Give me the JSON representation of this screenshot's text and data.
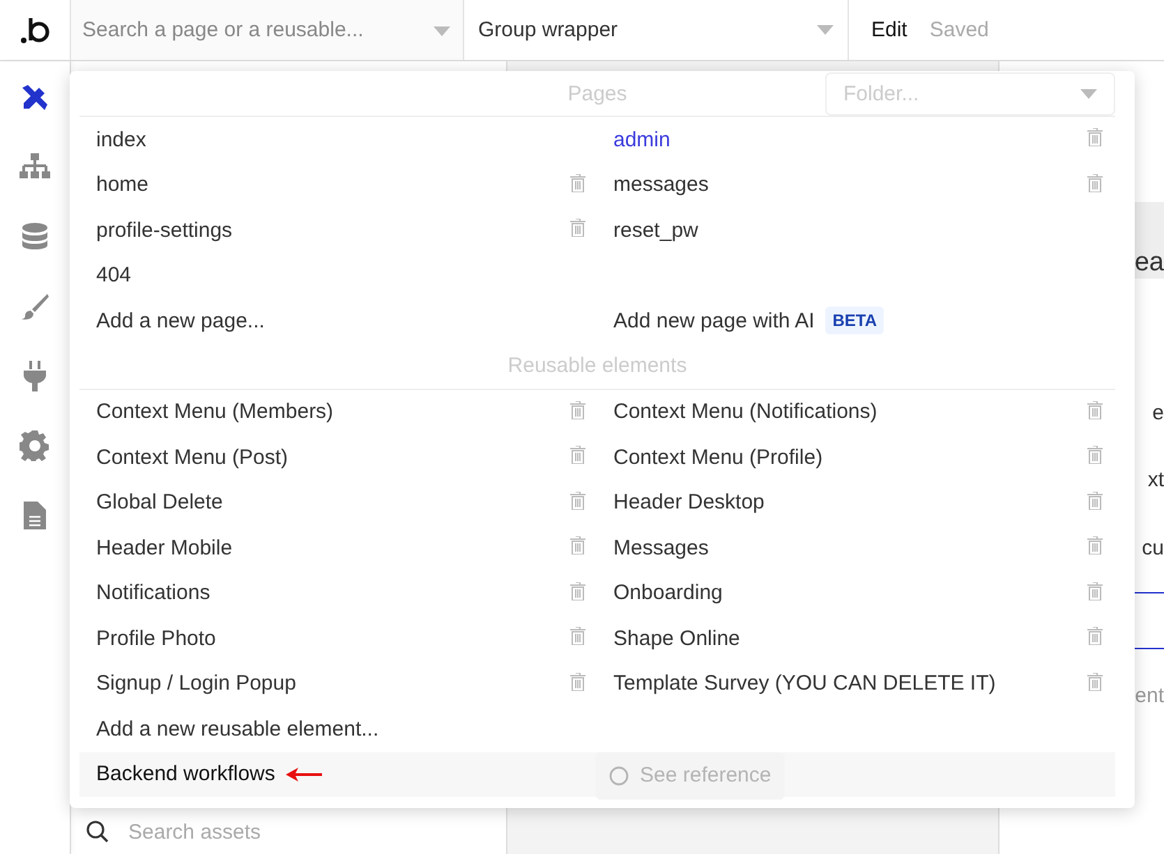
{
  "topbar": {
    "search": {
      "placeholder": "Search a page or a reusable..."
    },
    "element_select": {
      "value": "Group wrapper"
    },
    "mode": "Edit",
    "status": "Saved"
  },
  "sidebar": {
    "items": [
      {
        "kind": "design",
        "selected": true
      },
      {
        "kind": "hierarchy",
        "selected": false
      },
      {
        "kind": "data",
        "selected": false
      },
      {
        "kind": "styles",
        "selected": false
      },
      {
        "kind": "plugins",
        "selected": false
      },
      {
        "kind": "settings",
        "selected": false
      },
      {
        "kind": "logs",
        "selected": false
      }
    ]
  },
  "background": {
    "fragments": [
      "ea",
      "e",
      "xt",
      "cu",
      "ent"
    ],
    "see_reference": "See reference",
    "assets_search": {
      "placeholder": "Search assets"
    }
  },
  "dropdown": {
    "pages_title": "Pages",
    "folder": {
      "placeholder": "Folder..."
    },
    "pages": [
      {
        "name": "index",
        "selected": false,
        "deletable": false
      },
      {
        "name": "admin",
        "selected": true,
        "deletable": true
      },
      {
        "name": "home",
        "selected": false,
        "deletable": true
      },
      {
        "name": "messages",
        "selected": false,
        "deletable": true
      },
      {
        "name": "profile-settings",
        "selected": false,
        "deletable": true
      },
      {
        "name": "reset_pw",
        "selected": false,
        "deletable": false
      },
      {
        "name": "404",
        "selected": false,
        "deletable": false
      }
    ],
    "add_page": "Add a new page...",
    "add_page_ai": "Add new page with AI",
    "ai_badge": "BETA",
    "reusables_title": "Reusable elements",
    "reusables": [
      {
        "name": "Context Menu (Members)",
        "deletable": true
      },
      {
        "name": "Context Menu (Notifications)",
        "deletable": true
      },
      {
        "name": "Context Menu (Post)",
        "deletable": true
      },
      {
        "name": "Context Menu (Profile)",
        "deletable": true
      },
      {
        "name": "Global Delete",
        "deletable": true
      },
      {
        "name": "Header Desktop",
        "deletable": true
      },
      {
        "name": "Header Mobile",
        "deletable": true
      },
      {
        "name": "Messages",
        "deletable": true
      },
      {
        "name": "Notifications",
        "deletable": true
      },
      {
        "name": "Onboarding",
        "deletable": true
      },
      {
        "name": "Profile Photo",
        "deletable": true
      },
      {
        "name": "Shape Online",
        "deletable": true
      },
      {
        "name": "Signup / Login Popup",
        "deletable": true
      },
      {
        "name": "Template Survey (YOU CAN DELETE IT)",
        "deletable": true
      }
    ],
    "add_reusable": "Add a new reusable element...",
    "backend": "Backend workflows"
  }
}
